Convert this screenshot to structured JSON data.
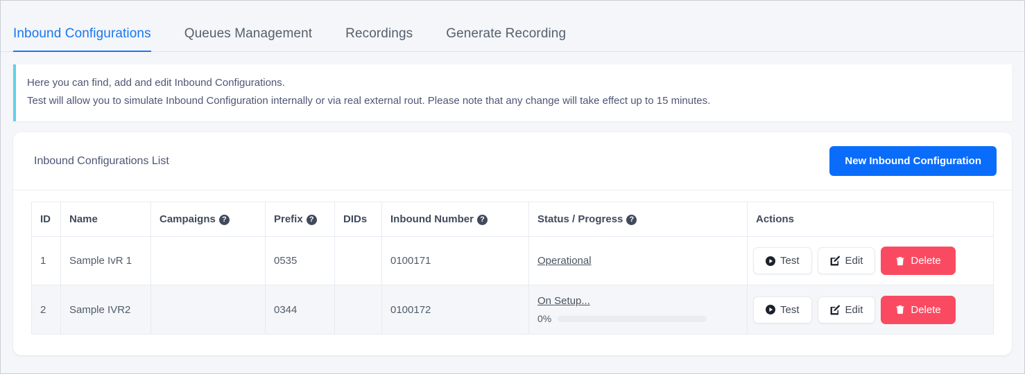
{
  "tabs": [
    {
      "label": "Inbound Configurations",
      "active": true
    },
    {
      "label": "Queues Management",
      "active": false
    },
    {
      "label": "Recordings",
      "active": false
    },
    {
      "label": "Generate Recording",
      "active": false
    }
  ],
  "banner": {
    "line1": "Here you can find, add and edit Inbound Configurations.",
    "line2": "Test will allow you to simulate Inbound Configuration internally or via real external rout. Please note that any change will take effect up to 15 minutes."
  },
  "card": {
    "title": "Inbound Configurations List",
    "new_button": "New Inbound Configuration"
  },
  "table": {
    "headers": [
      {
        "label": "ID",
        "help": false
      },
      {
        "label": "Name",
        "help": false
      },
      {
        "label": "Campaigns",
        "help": true
      },
      {
        "label": "Prefix",
        "help": true
      },
      {
        "label": "DIDs",
        "help": false
      },
      {
        "label": "Inbound Number",
        "help": true
      },
      {
        "label": "Status / Progress",
        "help": true
      },
      {
        "label": "Actions",
        "help": false
      }
    ],
    "help_glyph": "?",
    "rows": [
      {
        "id": "1",
        "name": "Sample IvR 1",
        "campaigns": "",
        "prefix": "0535",
        "dids": "",
        "inbound_number": "0100171",
        "status": "Operational",
        "has_progress": false,
        "progress_pct": "",
        "progress_value": 0,
        "actions": {
          "test": "Test",
          "edit": "Edit",
          "delete": "Delete"
        }
      },
      {
        "id": "2",
        "name": "Sample IVR2",
        "campaigns": "",
        "prefix": "0344",
        "dids": "",
        "inbound_number": "0100172",
        "status": "On Setup...",
        "has_progress": true,
        "progress_pct": "0%",
        "progress_value": 0,
        "actions": {
          "test": "Test",
          "edit": "Edit",
          "delete": "Delete"
        }
      }
    ]
  },
  "colors": {
    "accent_blue": "#0a6cfb",
    "tab_active": "#1877f2",
    "danger": "#fa4a61",
    "banner_border": "#62d0e8",
    "page_bg": "#f4f6f9"
  },
  "icons": {
    "help": "help-circle-icon",
    "test": "play-circle-icon",
    "edit": "pencil-square-icon",
    "delete": "trash-icon"
  }
}
